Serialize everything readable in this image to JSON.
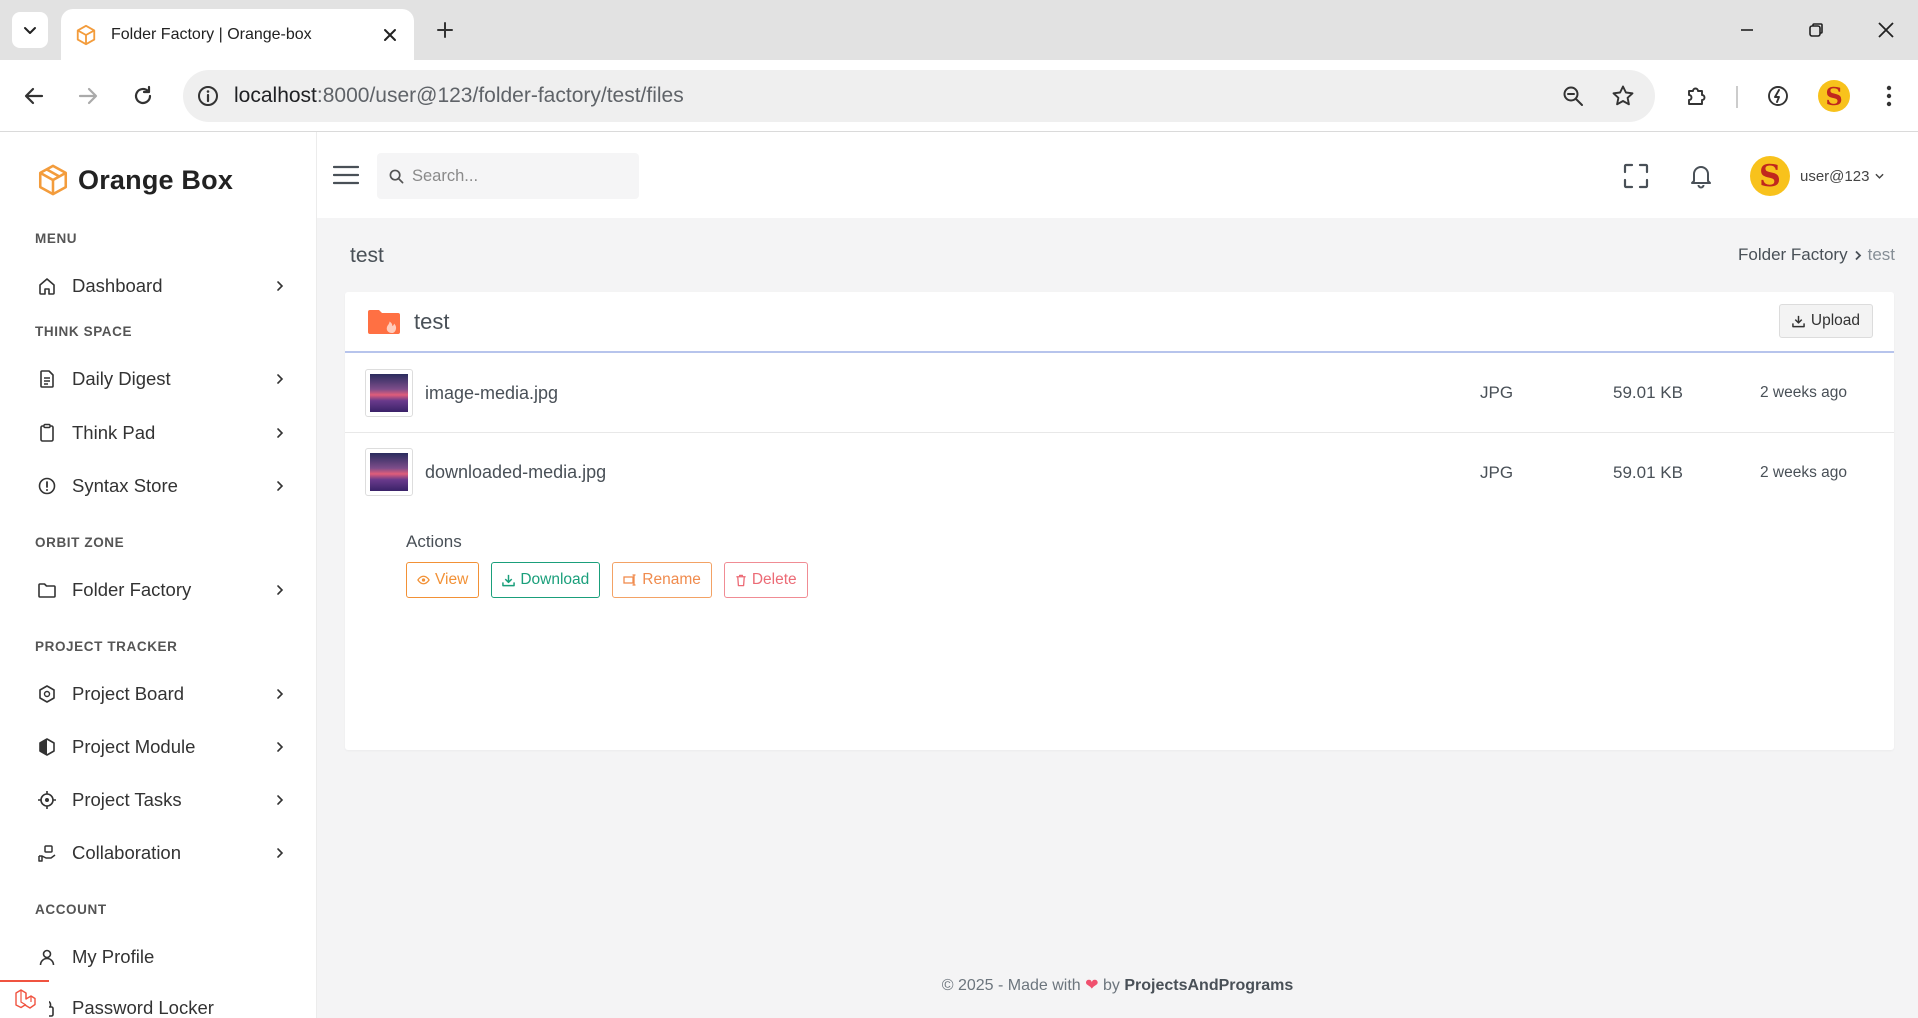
{
  "browser": {
    "tab_title": "Folder Factory | Orange-box",
    "url_host": "localhost",
    "url_path": ":8000/user@123/folder-factory/test/files"
  },
  "brand": {
    "name": "Orange Box"
  },
  "sidebar": {
    "sections": [
      {
        "heading": "MENU",
        "items": [
          {
            "label": "Dashboard",
            "icon": "home-icon"
          }
        ]
      },
      {
        "heading": "THINK SPACE",
        "items": [
          {
            "label": "Daily Digest",
            "icon": "document-icon"
          },
          {
            "label": "Think Pad",
            "icon": "clipboard-icon"
          },
          {
            "label": "Syntax Store",
            "icon": "alert-circle-icon"
          }
        ]
      },
      {
        "heading": "ORBIT ZONE",
        "items": [
          {
            "label": "Folder Factory",
            "icon": "folder-icon"
          }
        ]
      },
      {
        "heading": "PROJECT TRACKER",
        "items": [
          {
            "label": "Project Board",
            "icon": "hexagon-icon"
          },
          {
            "label": "Project Module",
            "icon": "half-hexagon-icon"
          },
          {
            "label": "Project Tasks",
            "icon": "target-icon"
          },
          {
            "label": "Collaboration",
            "icon": "hand-share-icon"
          }
        ]
      },
      {
        "heading": "ACCOUNT",
        "items": [
          {
            "label": "My Profile",
            "icon": "user-icon"
          },
          {
            "label": "Password Locker",
            "icon": "lock-icon"
          }
        ]
      }
    ]
  },
  "topbar": {
    "search_placeholder": "Search...",
    "user_name": "user@123",
    "avatar_letter": "S"
  },
  "page": {
    "title": "test",
    "breadcrumb": [
      "Folder Factory",
      "test"
    ]
  },
  "folder": {
    "name": "test",
    "upload_label": "Upload",
    "files": [
      {
        "name": "image-media.jpg",
        "type": "JPG",
        "size": "59.01 KB",
        "date": "2 weeks ago"
      },
      {
        "name": "downloaded-media.jpg",
        "type": "JPG",
        "size": "59.01 KB",
        "date": "2 weeks ago"
      }
    ],
    "actions_label": "Actions",
    "actions": {
      "view": "View",
      "download": "Download",
      "rename": "Rename",
      "delete": "Delete"
    }
  },
  "footer": {
    "prefix": "© 2025 - Made with",
    "by": "by",
    "author": "ProjectsAndPrograms"
  },
  "colors": {
    "brand_orange": "#f39c3c",
    "folder_orange": "#ff7043",
    "heart": "#f0506e"
  }
}
